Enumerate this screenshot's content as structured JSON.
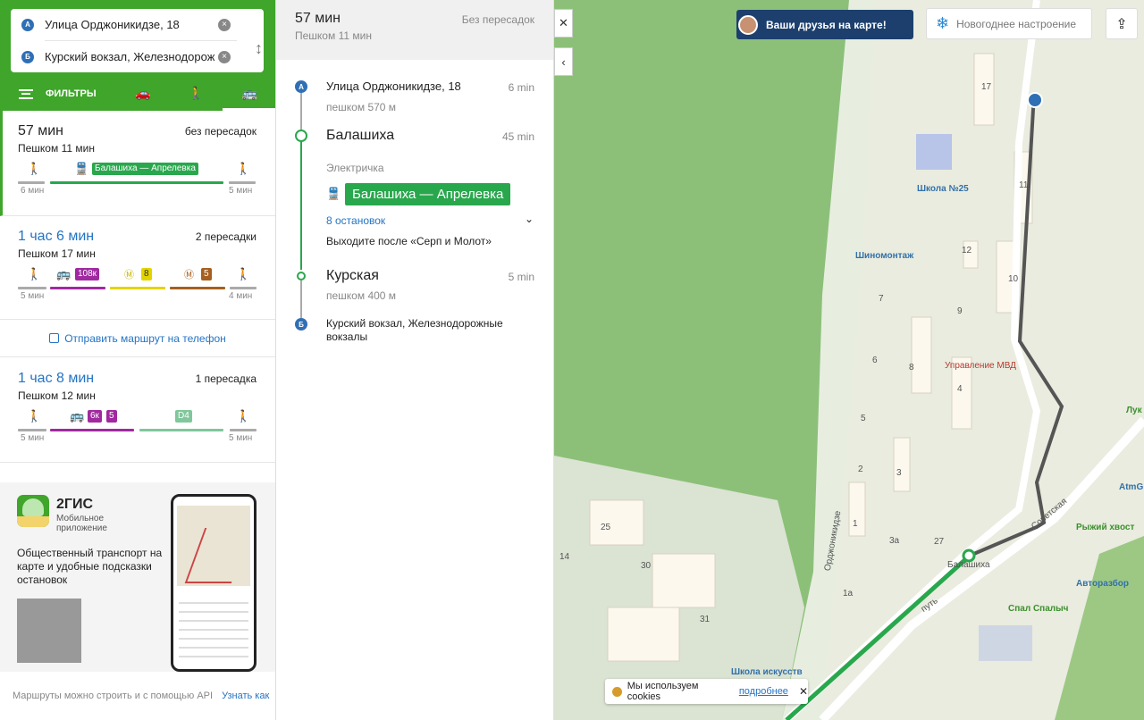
{
  "search": {
    "from_pin": "A",
    "from_text": "Улица Орджоникидзе, 18",
    "to_pin": "Б",
    "to_text": "Курский вокзал, Железнодорож"
  },
  "tabs": {
    "filters_label": "ФИЛЬТРЫ"
  },
  "routes": [
    {
      "time": "57 мин",
      "transfers": "без пересадок",
      "walk": "Пешком 11 мин",
      "line_label": "Балашиха — Апрелевка",
      "walk_start": "6 мин",
      "walk_end": "5 мин"
    },
    {
      "time": "1 час 6 мин",
      "transfers": "2 пересадки",
      "walk": "Пешком 17 мин",
      "bus": "108к",
      "metro1": "8",
      "metro2": "5",
      "walk_start": "5 мин",
      "walk_end": "4 мин"
    },
    {
      "time": "1 час 8 мин",
      "transfers": "1 пересадка",
      "walk": "Пешком 12 мин",
      "bus1": "6к",
      "bus2": "5",
      "d_line": "D4",
      "walk_start": "5 мин",
      "walk_end": "5 мин"
    }
  ],
  "send_route": "Отправить маршрут на телефон",
  "promo": {
    "brand": "2ГИС",
    "subtitle": "Мобильное приложение",
    "description": "Общественный транспорт на карте и удобные подсказки остановок"
  },
  "footer": {
    "text": "Маршруты можно строить и с помощью API",
    "link": "Узнать как"
  },
  "detail": {
    "time": "57 мин",
    "walk": "Пешком 11 мин",
    "transfers": "Без пересадок",
    "start_name": "Улица Орджоникидзе, 18",
    "start_dur": "6 min",
    "start_walk": "пешком 570 м",
    "board_name": "Балашиха",
    "board_dur": "45 min",
    "mode": "Электричка",
    "line": "Балашиха — Апрелевка",
    "stops": "8 остановок",
    "exit_hint": "Выходите после «Серп и Молот»",
    "alight_name": "Курская",
    "alight_dur": "5 min",
    "alight_walk": "пешком 400 м",
    "end_name": "Курский вокзал, Железнодорожные вокзалы"
  },
  "map": {
    "friends_banner": "Ваши друзья на карте!",
    "new_year": "Новогоднее настроение",
    "labels": {
      "school": "Школа №25",
      "tire": "Шиномонтаж",
      "mvd": "Управление МВД",
      "balashikha": "Балашиха",
      "sovetskaya": "Советская",
      "ordzhonikidze": "Орджоникидзе",
      "ryzhiy": "Рыжий хвост",
      "avtorazbor": "Авторазбор",
      "spal": "Спал Спалыч",
      "school_art": "Школа искусств",
      "atm": "AtmG",
      "luk": "Лук",
      "put": "путь"
    },
    "houses": [
      "17",
      "11",
      "12",
      "10",
      "9",
      "7",
      "8",
      "6",
      "4",
      "5",
      "2",
      "3",
      "1",
      "3а",
      "27",
      "25",
      "30",
      "31",
      "14",
      "1а"
    ]
  },
  "cookie": {
    "text": "Мы используем cookies",
    "link": "подробнее"
  }
}
